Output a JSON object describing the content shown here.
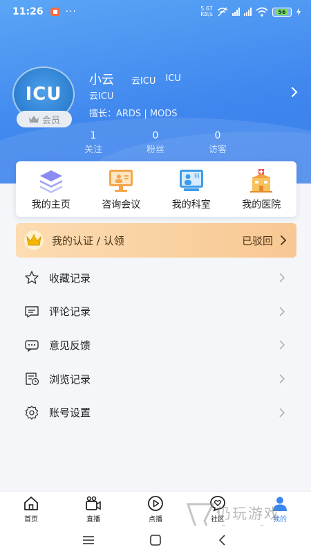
{
  "status_bar": {
    "time": "11:26",
    "dots": "···",
    "net_speed": "5.67",
    "net_unit": "KB/s",
    "battery": "56"
  },
  "profile": {
    "avatar_text": "ICU",
    "member_label": "会员",
    "name": "小云",
    "tag1": "云ICU",
    "tag2": "ICU",
    "org": "云ICU",
    "specialty": "擅长：ARDS | MODS"
  },
  "stats": [
    {
      "value": "1",
      "label": "关注"
    },
    {
      "value": "0",
      "label": "粉丝"
    },
    {
      "value": "0",
      "label": "访客"
    }
  ],
  "quick_menu": [
    {
      "label": "我的主页",
      "icon": "layers-icon"
    },
    {
      "label": "咨询会议",
      "icon": "consult-meeting-icon"
    },
    {
      "label": "我的科室",
      "icon": "department-icon"
    },
    {
      "label": "我的医院",
      "icon": "hospital-icon"
    }
  ],
  "certification": {
    "label": "我的认证 / 认领",
    "status": "已驳回"
  },
  "menu": [
    {
      "label": "收藏记录",
      "icon": "star-icon"
    },
    {
      "label": "评论记录",
      "icon": "comment-icon"
    },
    {
      "label": "意见反馈",
      "icon": "feedback-icon"
    },
    {
      "label": "浏览记录",
      "icon": "history-icon"
    },
    {
      "label": "账号设置",
      "icon": "gear-icon"
    }
  ],
  "bottom_nav": [
    {
      "label": "首页",
      "icon": "home-icon"
    },
    {
      "label": "直播",
      "icon": "live-camera-icon"
    },
    {
      "label": "点播",
      "icon": "play-icon"
    },
    {
      "label": "社区",
      "icon": "community-icon"
    },
    {
      "label": "我的",
      "icon": "user-icon"
    }
  ],
  "watermark": {
    "title": "仍玩游戏",
    "subtitle": "Rengwan Games"
  },
  "colors": {
    "primary": "#3f86ee",
    "cert_bg": "#fcdcb1",
    "active_nav": "#3b86ee"
  }
}
